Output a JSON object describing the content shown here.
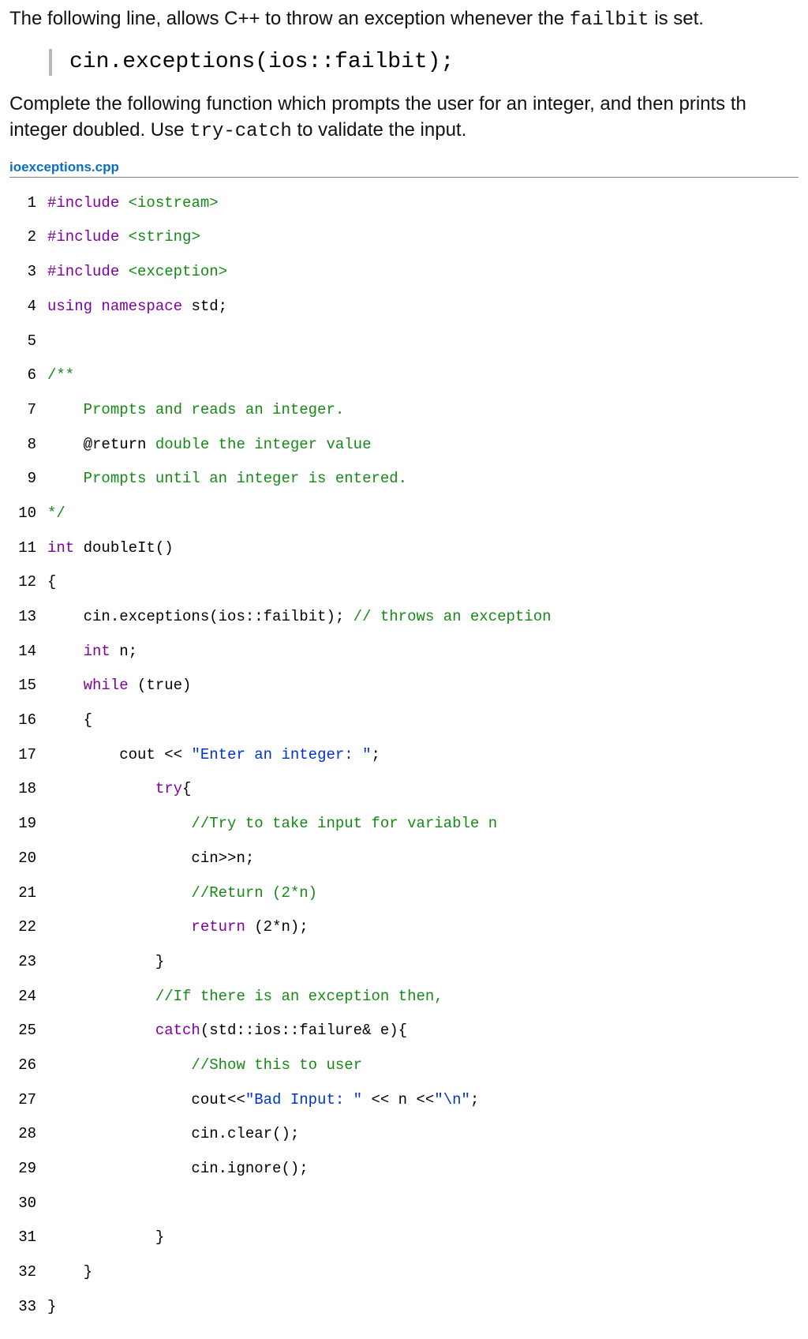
{
  "intro1_pre": "The following line, allows C++ to throw an exception whenever the ",
  "intro1_code": "failbit",
  "intro1_post": " is set.",
  "snippet": "cin.exceptions(ios::failbit);",
  "intro2_pre": "Complete the following function which prompts the user for an integer, and then prints th integer doubled. Use ",
  "intro2_code": "try-catch",
  "intro2_post": " to validate the input.",
  "filename": "ioexceptions.cpp",
  "lines": {
    "1": {
      "inc": "#include ",
      "hdr": "<iostream>"
    },
    "2": {
      "inc": "#include ",
      "hdr": "<string>"
    },
    "3": {
      "inc": "#include ",
      "hdr": "<exception>"
    },
    "4": {
      "kw1": "using ",
      "kw2": "namespace",
      "rest": " std;"
    },
    "5": {
      "rest": ""
    },
    "6": {
      "cm": "/**"
    },
    "7": {
      "cm": "    Prompts and reads an integer."
    },
    "8a": "    @return ",
    "8b": "double the integer value",
    "9": {
      "cm": "    Prompts until an integer is entered."
    },
    "10": {
      "cm": "*/"
    },
    "11": {
      "kw": "int",
      "rest": " doubleIt()"
    },
    "12": {
      "rest": "{"
    },
    "13a": "    cin.exceptions(ios::failbit); ",
    "13b": "// throws an exception",
    "14": {
      "kw": "    int",
      "rest": " n;"
    },
    "15": {
      "kw": "    while",
      "rest": " (true)"
    },
    "16": {
      "rest": "    {"
    },
    "17a": "        cout << ",
    "17b": "\"Enter an integer: \"",
    "17c": ";",
    "18": {
      "kw": "            try",
      "rest": "{"
    },
    "19": {
      "cm": "                //Try to take input for variable n"
    },
    "20": {
      "rest": "                cin>>n;"
    },
    "21": {
      "cm": "                //Return (2*n)"
    },
    "22": {
      "kw": "                return",
      "rest": " (2*n);"
    },
    "23": {
      "rest": "            }"
    },
    "24": {
      "cm": "            //If there is an exception then,"
    },
    "25": {
      "kw": "            catch",
      "rest": "(std::ios::failure& e){"
    },
    "26": {
      "cm": "                //Show this to user"
    },
    "27a": "                cout<<",
    "27b": "\"Bad Input: \"",
    "27c": " << n <<",
    "27d": "\"\\n\"",
    "27e": ";",
    "28": {
      "rest": "                cin.clear();"
    },
    "29": {
      "rest": "                cin.ignore();"
    },
    "30": {
      "rest": ""
    },
    "31": {
      "rest": "            }"
    },
    "32": {
      "rest": "    }"
    },
    "33": {
      "rest": "}"
    }
  },
  "numbers": [
    "1",
    "2",
    "3",
    "4",
    "5",
    "6",
    "7",
    "8",
    "9",
    "10",
    "11",
    "12",
    "13",
    "14",
    "15",
    "16",
    "17",
    "18",
    "19",
    "20",
    "21",
    "22",
    "23",
    "24",
    "25",
    "26",
    "27",
    "28",
    "29",
    "30",
    "31",
    "32",
    "33"
  ]
}
